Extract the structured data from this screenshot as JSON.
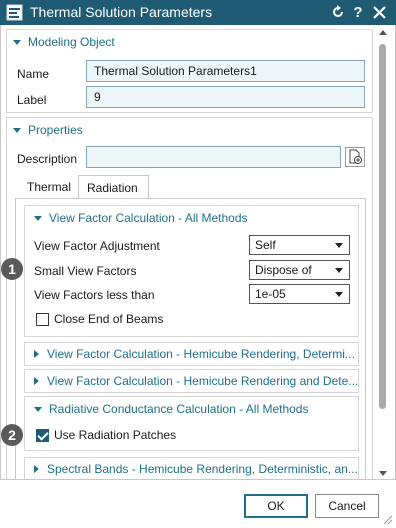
{
  "window": {
    "title": "Thermal Solution Parameters",
    "reset_icon": "reset-icon",
    "help_label": "?",
    "close_icon": "close-icon"
  },
  "modeling_object": {
    "header": "Modeling Object",
    "name_label": "Name",
    "name_value": "Thermal Solution Parameters1",
    "label_label": "Label",
    "label_value": "9"
  },
  "properties": {
    "header": "Properties",
    "description_label": "Description",
    "description_value": "",
    "tabs": [
      {
        "label": "Thermal",
        "active": false
      },
      {
        "label": "Radiation",
        "active": true
      }
    ]
  },
  "view_factor_all": {
    "header": "View Factor Calculation - All Methods",
    "adjustment_label": "View Factor Adjustment",
    "adjustment_value": "Self",
    "small_label": "Small View Factors",
    "small_value": "Dispose of",
    "less_than_label": "View Factors less than",
    "less_than_value": "1e-05",
    "close_end_label": "Close End of Beams",
    "close_end_checked": false
  },
  "collapsed_groups": [
    {
      "label": "View Factor Calculation - Hemicube Rendering, Determi..."
    },
    {
      "label": "View Factor Calculation - Hemicube Rendering and Dete..."
    }
  ],
  "radiative": {
    "header": "Radiative Conductance Calculation - All Methods",
    "use_patches_label": "Use Radiation Patches",
    "use_patches_checked": true
  },
  "spectral": {
    "label": "Spectral Bands - Hemicube Rendering, Deterministic, an..."
  },
  "callouts": [
    "1",
    "2"
  ],
  "footer": {
    "ok_label": "OK",
    "cancel_label": "Cancel"
  },
  "colors": {
    "titlebar": "#1f5b73",
    "accent": "#1f6f8b",
    "field_bg": "#eef6f9"
  }
}
